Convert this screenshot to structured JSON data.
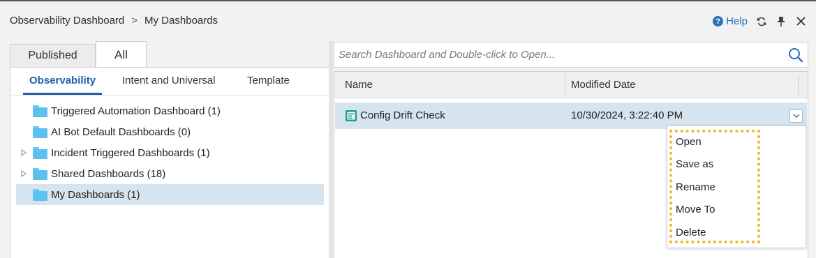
{
  "breadcrumb": {
    "root": "Observability Dashboard",
    "separator": ">",
    "current": "My Dashboards"
  },
  "toolbar": {
    "help_label": "Help",
    "help_icon": "?",
    "refresh_icon": "refresh-icon",
    "pin_icon": "pin-icon",
    "close_icon": "close-icon"
  },
  "top_tabs": {
    "published": "Published",
    "all": "All",
    "active": "All"
  },
  "sub_tabs": {
    "observability": "Observability",
    "intent": "Intent and Universal",
    "template": "Template",
    "active": "Observability"
  },
  "tree": {
    "items": [
      {
        "label": "Triggered Automation Dashboard (1)",
        "expandable": false,
        "selected": false
      },
      {
        "label": "AI Bot Default Dashboards (0)",
        "expandable": false,
        "selected": false
      },
      {
        "label": "Incident Triggered Dashboards (1)",
        "expandable": true,
        "selected": false
      },
      {
        "label": "Shared Dashboards (18)",
        "expandable": true,
        "selected": false
      },
      {
        "label": "My Dashboards (1)",
        "expandable": false,
        "selected": true
      }
    ],
    "folder_color": "#5cc1ef",
    "selected_color": "#d5e4ef"
  },
  "search": {
    "placeholder": "Search Dashboard and Double-click to Open...",
    "value": ""
  },
  "grid": {
    "columns": {
      "name": "Name",
      "modified": "Modified Date"
    },
    "rows": [
      {
        "name": "Config Drift Check",
        "modified": "10/30/2024, 3:22:40 PM",
        "selected": true
      }
    ]
  },
  "context_menu": {
    "items": [
      "Open",
      "Save as",
      "Rename",
      "Move To",
      "Delete"
    ],
    "highlight_color": "#f2b71f"
  },
  "colors": {
    "accent": "#1f5fa8",
    "link": "#2b6fbd",
    "doc_icon": "#1a9e8f"
  }
}
